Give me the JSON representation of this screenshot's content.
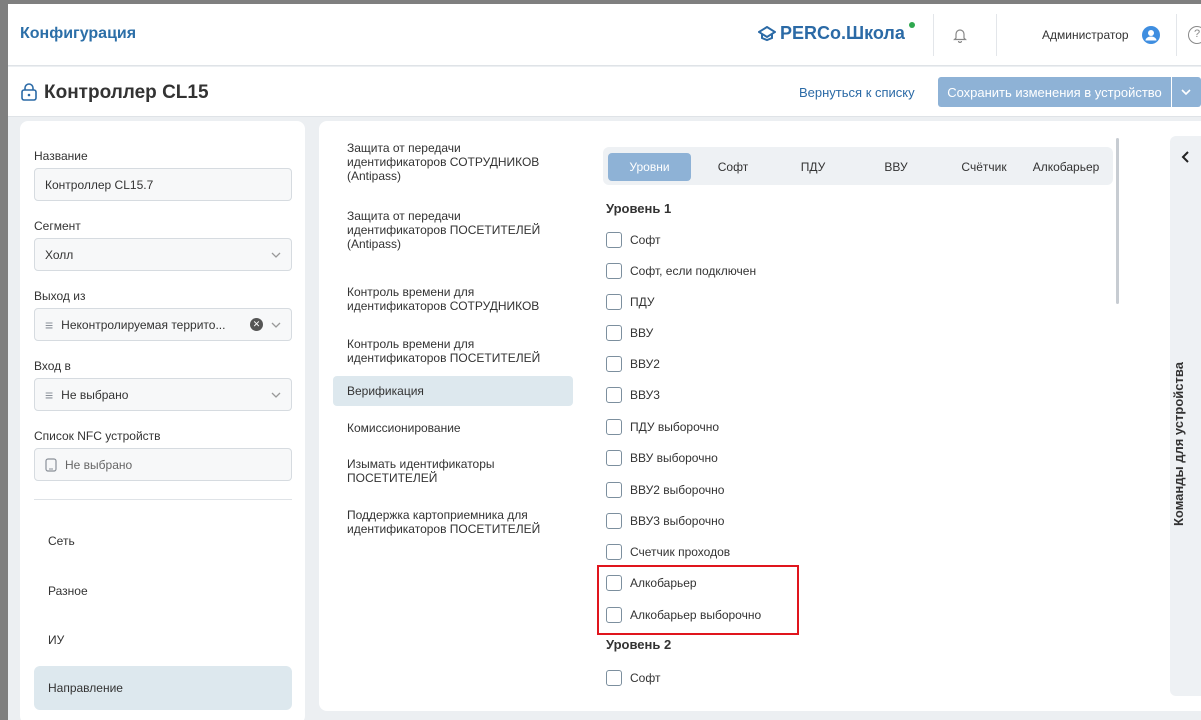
{
  "app": {
    "title": "Конфигурация",
    "brand": "PERCo.Школа",
    "user": "Администратор",
    "help": "?"
  },
  "header": {
    "page_title": "Контроллер CL15",
    "back_link": "Вернуться к списку",
    "save_button": "Сохранить изменения в устройство"
  },
  "form": {
    "name_label": "Название",
    "name_value": "Контроллер CL15.7",
    "segment_label": "Сегмент",
    "segment_value": "Холл",
    "exit_label": "Выход из",
    "exit_value": "Неконтролируемая террито...",
    "entry_label": "Вход в",
    "entry_value": "Не выбрано",
    "nfc_label": "Список NFC устройств",
    "nfc_value": "Не выбрано"
  },
  "left_nav": [
    "Сеть",
    "Разное",
    "ИУ",
    "Направление"
  ],
  "sections": [
    "Защита от передачи идентификаторов СОТРУДНИКОВ (Antipass)",
    "Защита от передачи идентификаторов ПОСЕТИТЕЛЕЙ (Antipass)",
    "Контроль времени для идентификаторов СОТРУДНИКОВ",
    "Контроль времени для идентификаторов ПОСЕТИТЕЛЕЙ",
    "Верификация",
    "Комиссионирование",
    "Изымать идентификаторы ПОСЕТИТЕЛЕЙ",
    "Поддержка картоприемника для идентификаторов ПОСЕТИТЕЛЕЙ"
  ],
  "tabs": [
    "Уровни",
    "Софт",
    "ПДУ",
    "ВВУ",
    "Счётчик",
    "Алкобарьер"
  ],
  "level1": {
    "title": "Уровень 1",
    "options": [
      "Софт",
      "Софт, если подключен",
      "ПДУ",
      "ВВУ",
      "ВВУ2",
      "ВВУ3",
      "ПДУ выборочно",
      "ВВУ выборочно",
      "ВВУ2 выборочно",
      "ВВУ3 выборочно",
      "Счетчик проходов",
      "Алкобарьер",
      "Алкобарьер выборочно"
    ]
  },
  "level2": {
    "title": "Уровень 2",
    "options": [
      "Софт"
    ]
  },
  "rail": {
    "label": "Команды для устройства"
  },
  "colors": {
    "accent": "#8eb2d6",
    "link": "#2b6aa6",
    "highlight": "#e0151d"
  }
}
